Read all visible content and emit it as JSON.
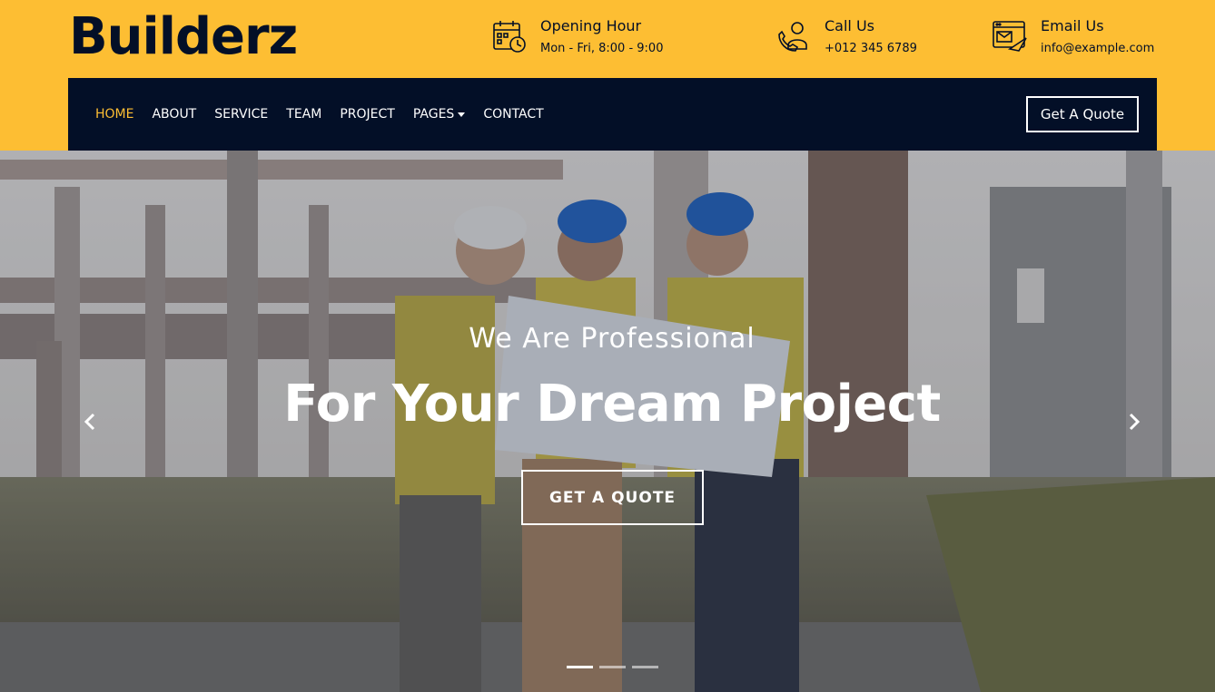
{
  "brand": {
    "name": "Builderz"
  },
  "top_info": [
    {
      "icon": "calendar-clock-icon",
      "title": "Opening Hour",
      "detail": "Mon - Fri, 8:00 - 9:00"
    },
    {
      "icon": "phone-support-icon",
      "title": "Call Us",
      "detail": "+012 345 6789"
    },
    {
      "icon": "email-browser-icon",
      "title": "Email Us",
      "detail": "info@example.com"
    }
  ],
  "nav": {
    "items": [
      {
        "label": "HOME",
        "active": true
      },
      {
        "label": "ABOUT"
      },
      {
        "label": "SERVICE"
      },
      {
        "label": "TEAM"
      },
      {
        "label": "PROJECT"
      },
      {
        "label": "PAGES",
        "dropdown": true
      },
      {
        "label": "CONTACT"
      }
    ],
    "cta_label": "Get A Quote"
  },
  "hero": {
    "subtitle": "We Are Professional",
    "title": "For Your Dream Project",
    "button_label": "GET A QUOTE",
    "active_slide": 1,
    "slide_count": 3
  },
  "colors": {
    "accent": "#FDBE33",
    "dark": "#030F27",
    "white": "#FFFFFF"
  }
}
